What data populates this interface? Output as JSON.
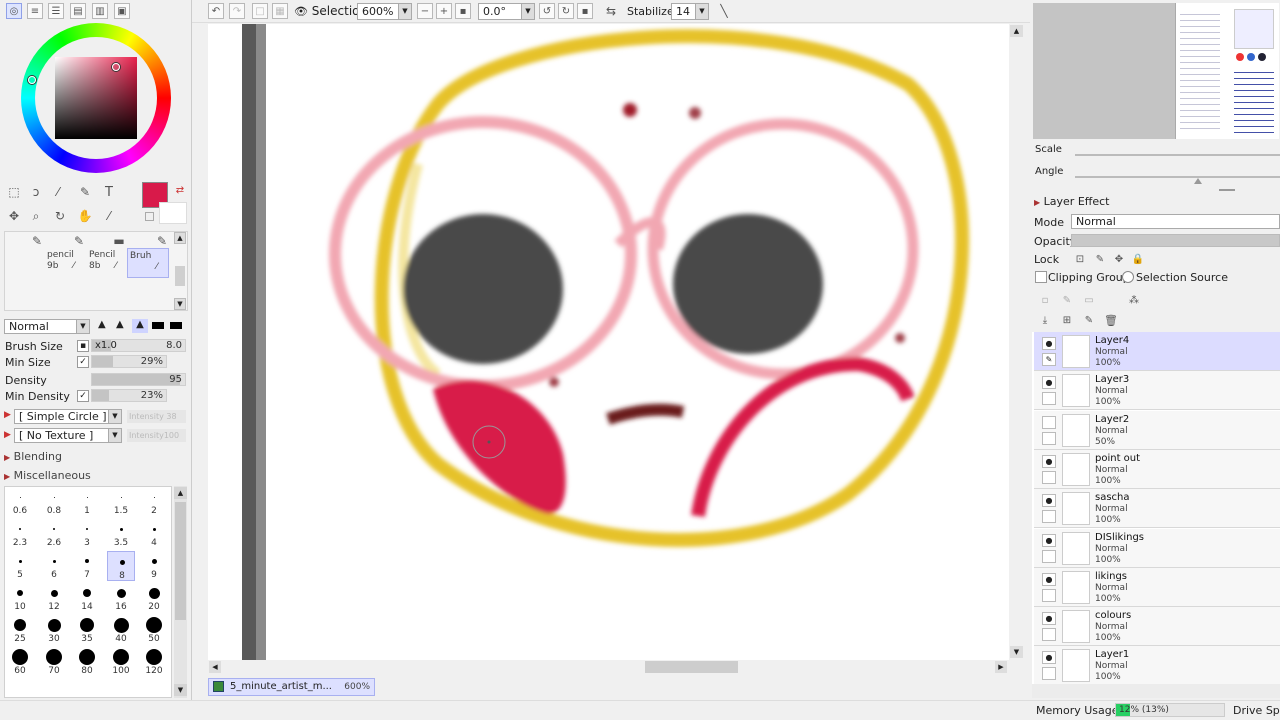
{
  "toolbar": {
    "selection_label": "Selection",
    "zoom": "600%",
    "angle": "0.0°",
    "stabilizer_label": "Stabilizer",
    "stabilizer_value": "14"
  },
  "color": {
    "current_hex": "#d81a4a"
  },
  "tools": {
    "text_tool": "T",
    "brush_presets": [
      {
        "label": "pencil",
        "sub": "9b"
      },
      {
        "label": "Pencil",
        "sub": "8b"
      },
      {
        "label": "Bruh",
        "sub": ""
      }
    ]
  },
  "brush": {
    "blend_mode": "Normal",
    "size_label": "Brush Size",
    "size_mult": "x1.0",
    "size_value": "8.0",
    "min_size_label": "Min Size",
    "min_size_value": "29%",
    "min_size_fill": 0.29,
    "density_label": "Density",
    "density_value": "95",
    "density_fill": 0.95,
    "min_density_label": "Min Density",
    "min_density_value": "23%",
    "min_density_fill": 0.23,
    "shape": "[ Simple Circle ]",
    "shape_intensity": "Intensity 38",
    "texture": "[ No Texture ]",
    "texture_intensity": "Intensity100",
    "blending_label": "Blending",
    "misc_label": "Miscellaneous",
    "sizes": [
      [
        "0.6",
        "0.8",
        "1",
        "1.5",
        "2"
      ],
      [
        "2.3",
        "2.6",
        "3",
        "3.5",
        "4"
      ],
      [
        "5",
        "6",
        "7",
        "8",
        "9"
      ],
      [
        "10",
        "12",
        "14",
        "16",
        "20"
      ],
      [
        "25",
        "30",
        "35",
        "40",
        "50"
      ],
      [
        "60",
        "70",
        "80",
        "100",
        "120"
      ]
    ],
    "selected_size": "8"
  },
  "document": {
    "tab_name": "5_minute_artist_m...",
    "tab_zoom": "600%"
  },
  "navigator": {
    "scale_label": "Scale",
    "angle_label": "Angle"
  },
  "layer_panel": {
    "effect_label": "Layer Effect",
    "mode_label": "Mode",
    "mode_value": "Normal",
    "opacity_label": "Opacity",
    "lock_label": "Lock",
    "clipping_label": "Clipping Group",
    "selection_source_label": "Selection Source",
    "layers": [
      {
        "name": "Layer4",
        "mode": "Normal",
        "opacity": "100%"
      },
      {
        "name": "Layer3",
        "mode": "Normal",
        "opacity": "100%"
      },
      {
        "name": "Layer2",
        "mode": "Normal",
        "opacity": "50%"
      },
      {
        "name": "point out",
        "mode": "Normal",
        "opacity": "100%"
      },
      {
        "name": "sascha",
        "mode": "Normal",
        "opacity": "100%"
      },
      {
        "name": "DISlikings",
        "mode": "Normal",
        "opacity": "100%"
      },
      {
        "name": "likings",
        "mode": "Normal",
        "opacity": "100%"
      },
      {
        "name": "colours",
        "mode": "Normal",
        "opacity": "100%"
      },
      {
        "name": "Layer1",
        "mode": "Normal",
        "opacity": "100%"
      }
    ]
  },
  "status": {
    "memory_label": "Memory Usage",
    "memory_value": "12% (13%)",
    "memory_fill": 0.13,
    "drive_label": "Drive Spa"
  }
}
